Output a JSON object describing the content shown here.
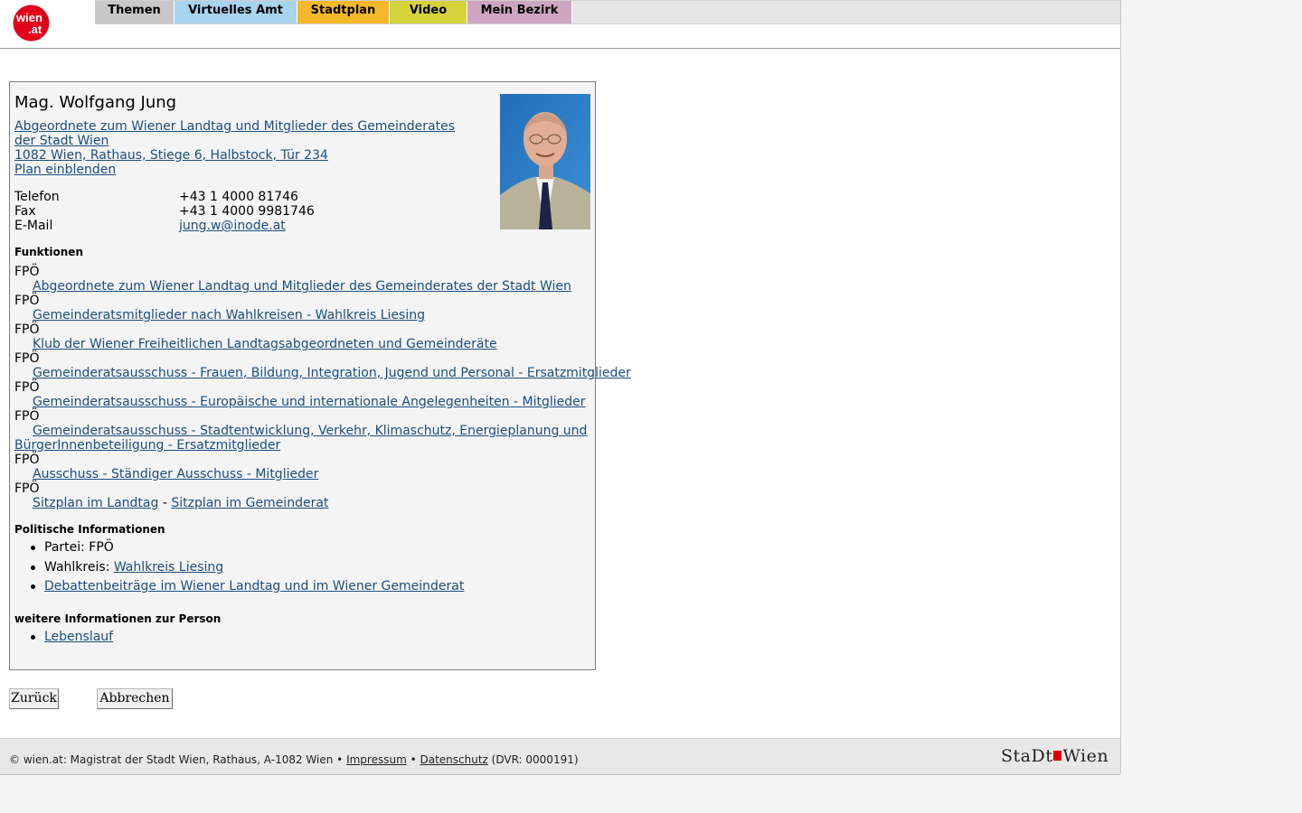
{
  "header": {
    "logo_text_top": "wien",
    "logo_text_bottom": ".at",
    "tabs": [
      {
        "label": "Themen",
        "color": "#c8c8c8"
      },
      {
        "label": "Virtuelles Amt",
        "color": "#a7d4ef"
      },
      {
        "label": "Stadtplan",
        "color": "#f5b82a"
      },
      {
        "label": "Video",
        "color": "#d5d33a"
      },
      {
        "label": "Mein Bezirk",
        "color": "#cfa6c2"
      }
    ]
  },
  "person": {
    "name": "Mag. Wolfgang Jung",
    "role_link": "Abgeordnete zum Wiener Landtag und Mitglieder des Gemeinderates der Stadt Wien",
    "address_link": "1082 Wien, Rathaus, Stiege 6, Halbstock, Tür 234",
    "plan_link": "Plan einblenden",
    "contacts": [
      {
        "label": "Telefon",
        "value": "+43 1 4000 81746",
        "is_link": false
      },
      {
        "label": "Fax",
        "value": "+43 1 4000 9981746",
        "is_link": false
      },
      {
        "label": "E-Mail",
        "value": "jung.w@inode.at",
        "is_link": true
      }
    ]
  },
  "funktionen": {
    "heading": "Funktionen",
    "items": [
      {
        "party": "FPÖ",
        "link": "Abgeordnete zum Wiener Landtag und Mitglieder des Gemeinderates der Stadt Wien"
      },
      {
        "party": "FPÖ",
        "link": "Gemeinderatsmitglieder nach Wahlkreisen - Wahlkreis Liesing"
      },
      {
        "party": "FPÖ",
        "link": "Klub der Wiener Freiheitlichen Landtagsabgeordneten und Gemeinderäte"
      },
      {
        "party": "FPÖ",
        "link": "Gemeinderatsausschuss - Frauen, Bildung, Integration, Jugend und Personal - Ersatzmitglieder"
      },
      {
        "party": "FPÖ",
        "link": "Gemeinderatsausschuss - Europäische und internationale Angelegenheiten - Mitglieder"
      },
      {
        "party": "FPÖ",
        "link_line1": "Gemeinderatsausschuss - Stadtentwicklung, Verkehr, Klimaschutz, Energieplanung und",
        "link_line2": "BürgerInnenbeteiligung - Ersatzmitglieder"
      },
      {
        "party": "FPÖ",
        "link": "Ausschuss - Ständiger Ausschuss - Mitglieder"
      },
      {
        "party": "FPÖ",
        "link_a": "Sitzplan im Landtag",
        "sep": " - ",
        "link_b": "Sitzplan im Gemeinderat"
      }
    ]
  },
  "politisch": {
    "heading": "Politische Informationen",
    "partei_label": "Partei: FPÖ",
    "wahlkreis_label": "Wahlkreis: ",
    "wahlkreis_link": "Wahlkreis Liesing",
    "debatten_link": "Debattenbeiträge im Wiener Landtag und im Wiener Gemeinderat"
  },
  "weitere": {
    "heading": "weitere Informationen zur Person",
    "lebenslauf_link": "Lebenslauf"
  },
  "buttons": {
    "back": "Zurück",
    "cancel": "Abbrechen"
  },
  "footer": {
    "text_prefix": "© wien.at: Magistrat der Stadt Wien, Rathaus, A-1082 Wien • ",
    "impressum": "Impressum",
    "sep": " • ",
    "datenschutz": "Datenschutz",
    "text_suffix": " (DVR: 0000191)",
    "brand_left": "StaDt",
    "brand_right": "Wien"
  }
}
